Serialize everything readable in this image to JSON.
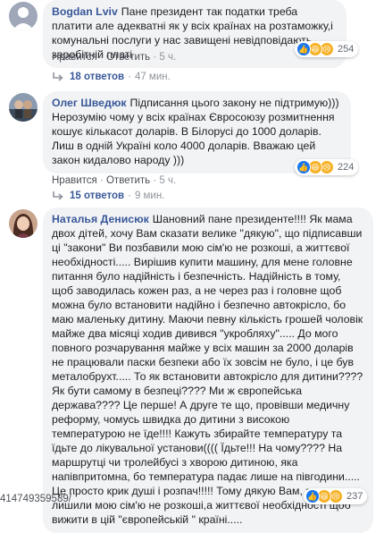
{
  "comments": [
    {
      "author": "Bogdan Lviv",
      "text": "Пане президент так податки треба платити але адекватні як у всіх країнах на розтаможку,і комунальні послуги у нас завищені невідповідають заробітній платі",
      "reaction_count": "254",
      "like_label": "Нравится",
      "reply_label": "Ответить",
      "time": "5 ч.",
      "replies_label": "18 ответов",
      "replies_time": "47 мин."
    },
    {
      "author": "Олег Шведюк",
      "text": "Підписання цього закону не підтримую))) Нерозумію чому у всіх країнах Євросоюзу розмитнення кошує кількасот доларів. В Білорусі до 1000 доларів. Лиш в одній Україні коло 4000 доларів. Вважаю цей закон кидалово народу )))",
      "reaction_count": "224",
      "like_label": "Нравится",
      "reply_label": "Ответить",
      "time": "5 ч.",
      "replies_label": "15 ответов",
      "replies_time": "9 мин."
    },
    {
      "author": "Наталья Денисюк",
      "text": "Шановний пане президенте!!!! Як мама двох дітей, хочу Вам сказати велике \"дякую\", що підписавши ці \"закони\" Ви позбавили мою сім'ю не розкоші, а життєвої необхідності..... Вирішив купити машину, для мене головне питання було надійність і безпечність. Надійність в тому, щоб заводилась кожен раз, а не через раз і головне щоб можна було встановити надійно і безпечно автокрісло, бо маю маленьку дитину. Маючи певну кількість грошей чоловік майже два місяці ходив дивився \"укробляху\"..... До мого повного розчарування майже у всіх машин за 2000 доларів не працювали паски безпеки або їх зовсім не було, і це був металобрухт..... То як встановити автокрісло для дитини???? Як бути самому в безпеці???? Ми ж європейська держава???? Це перше! А друге те що, провівши медичну реформу, чомусь швидка до дитини з високою температурою не їде!!!! Кажуть збирайте температуру та їдьте до лікувальної установи(((( Їдьте!!! На чому???? На маршрутці чи тролейбусі з хворою дитиною, яка напівпритомна, бо температура падає лише на півгодини..... Це просто крик душі і розпач!!!!! Тому дякую Вам, за те що лишили мою сім'ю не розкоші,а життєвої необхідності щоб вижити в цій \"європейській \" країні.....",
      "reaction_count": "237"
    }
  ],
  "footer_text": "414749359589/"
}
